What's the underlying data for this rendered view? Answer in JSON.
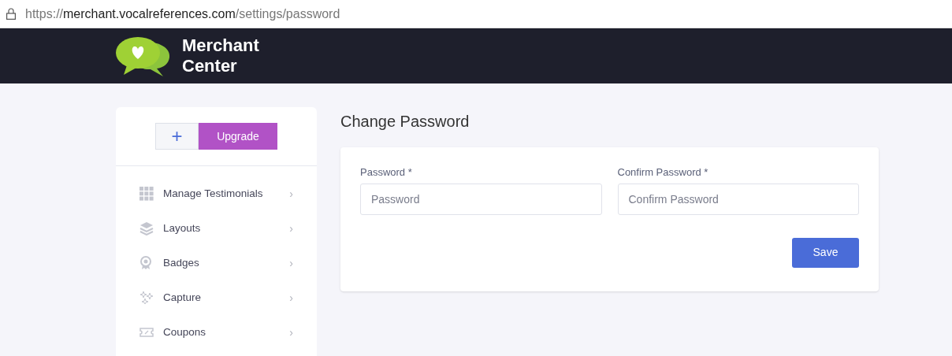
{
  "address_bar": {
    "scheme": "https://",
    "host": "merchant.vocalreferences.com",
    "path": "/settings/password"
  },
  "header": {
    "title_line_1": "Merchant",
    "title_line_2": "Center"
  },
  "sidebar": {
    "add_button": "+",
    "upgrade_button": "Upgrade",
    "items": [
      {
        "label": "Manage Testimonials",
        "kind": "grid",
        "chevron": "›"
      },
      {
        "label": "Layouts",
        "kind": "layers",
        "chevron": "›"
      },
      {
        "label": "Badges",
        "kind": "badge",
        "chevron": "›"
      },
      {
        "label": "Capture",
        "kind": "capture",
        "chevron": "›"
      },
      {
        "label": "Coupons",
        "kind": "coupon",
        "chevron": "›"
      }
    ]
  },
  "page_title": "Change Password",
  "form": {
    "fields": [
      {
        "label": "Password *",
        "placeholder": "Password"
      },
      {
        "label": "Confirm Password *",
        "placeholder": "Confirm Password"
      }
    ],
    "save_button": "Save"
  }
}
